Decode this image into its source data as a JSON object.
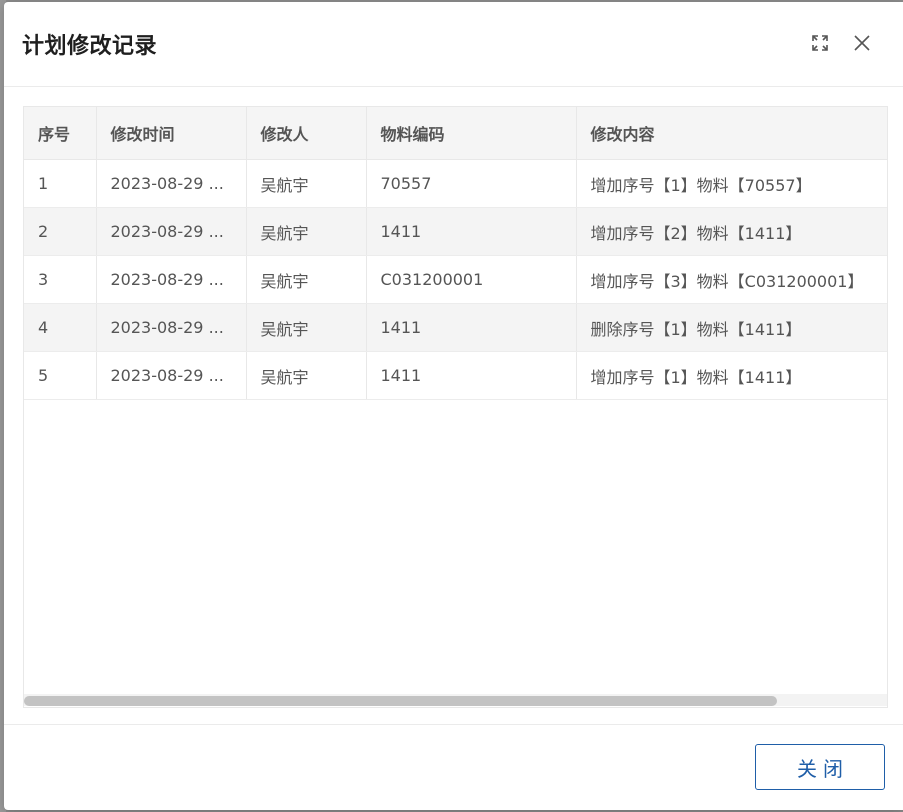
{
  "dialog": {
    "title": "计划修改记录",
    "close_label": "关闭"
  },
  "table": {
    "headers": [
      "序号",
      "修改时间",
      "修改人",
      "物料编码",
      "修改内容"
    ],
    "rows": [
      [
        "1",
        "2023-08-29 ...",
        "吴航宇",
        "70557",
        "增加序号【1】物料【70557】"
      ],
      [
        "2",
        "2023-08-29 ...",
        "吴航宇",
        "1411",
        "增加序号【2】物料【1411】"
      ],
      [
        "3",
        "2023-08-29 ...",
        "吴航宇",
        "C031200001",
        "增加序号【3】物料【C031200001】"
      ],
      [
        "4",
        "2023-08-29 ...",
        "吴航宇",
        "1411",
        "删除序号【1】物料【1411】"
      ],
      [
        "5",
        "2023-08-29 ...",
        "吴航宇",
        "1411",
        "增加序号【1】物料【1411】"
      ]
    ]
  },
  "icons": {
    "fullscreen": "fullscreen-icon",
    "close": "close-icon"
  },
  "colors": {
    "primary": "#1f5ea8",
    "header_bg": "#f5f5f5",
    "stripe_bg": "#f4f4f4"
  }
}
